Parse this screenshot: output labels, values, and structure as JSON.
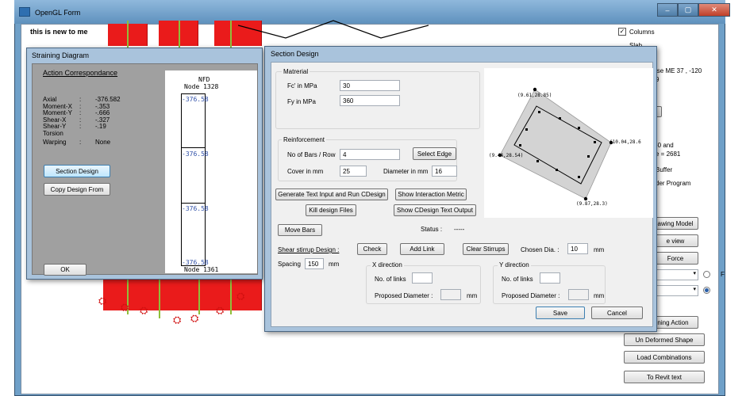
{
  "app": {
    "title": "OpenGL Form",
    "canvas_text": "this is new to me",
    "window_buttons": [
      "–",
      "▢",
      "✕"
    ]
  },
  "right_panel": {
    "columns_label": "Columns",
    "columns_checked": true,
    "partial_label_1": "Slab",
    "partial_texts": [
      "ise  ME  37 , -120",
      "9",
      "-0 and",
      "e = 2681",
      "Buffer",
      "der Program"
    ],
    "radio_label": "F",
    "buttons": {
      "drawing_model": "awing Model",
      "view": "e view",
      "force": "Force",
      "straining_action": "ning Action",
      "undeformed": "Un Deformed Shape",
      "load_combinations": "Load Combinations",
      "to_revit": "To Revit text"
    }
  },
  "straining": {
    "title": "Straining Diagram",
    "heading": "Action Correspondance",
    "rows": [
      {
        "label": "Axial",
        "sep": ":",
        "value": "-376.582"
      },
      {
        "label": "Moment-X",
        "sep": ":",
        "value": "-.353"
      },
      {
        "label": "Moment-Y",
        "sep": ":",
        "value": "-.666"
      },
      {
        "label": "Shear-X",
        "sep": ":",
        "value": "-.327"
      },
      {
        "label": "Shear-Y",
        "sep": ":",
        "value": "-.19"
      },
      {
        "label": "Torsion",
        "sep": "",
        "value": ""
      },
      {
        "label": "Warping",
        "sep": ":",
        "value": "None"
      }
    ],
    "section_design_btn": "Section Design",
    "copy_design_btn": "Copy Design From",
    "ok_btn": "OK",
    "diagram": {
      "title": "NFD",
      "node_top": "Node 1328",
      "node_bottom": "Node 1361",
      "value_1": "-376.58",
      "value_2": "-376.58",
      "value_3": "-376.58",
      "value_4": "-376.58"
    }
  },
  "section": {
    "title": "Section Design",
    "material": {
      "legend": "Matrerial",
      "fc_label": "Fc' in MPa",
      "fc_value": "30",
      "fy_label": "Fy in MPa",
      "fy_value": "360"
    },
    "reinforcement": {
      "legend": "Reinforcement",
      "bars_label": "No of Bars / Row",
      "bars_value": "4",
      "select_edge_btn": "Select Edge",
      "cover_label": "Cover in mm",
      "cover_value": "25",
      "diameter_label": "Diameter in mm",
      "diameter_value": "16"
    },
    "buttons": {
      "generate": "Generate Text Input and Run CDesign",
      "interaction": "Show Interaction Metric",
      "kill": "Kill design Files",
      "cdesign_output": "Show CDesign Text Output",
      "move_bars": "Move Bars",
      "check": "Check",
      "add_link": "Add Link",
      "clear_stirrups": "Clear Stirrups",
      "save": "Save",
      "cancel": "Cancel"
    },
    "status_label": "Status :",
    "status_value": "-----",
    "shear_label": "Shear stirrup Design :",
    "chosen_dia_label": "Chosen Dia. :",
    "chosen_dia_value": "10",
    "chosen_dia_unit": "mm",
    "spacing_label": "Spacing",
    "spacing_value": "150",
    "spacing_unit": "mm",
    "x_dir": {
      "legend": "X direction",
      "links_label": "No. of links",
      "links_value": "",
      "diam_label": "Proposed Diameter :",
      "diam_value": "",
      "unit": "mm"
    },
    "y_dir": {
      "legend": "Y direction",
      "links_label": "No. of links",
      "links_value": "",
      "diam_label": "Proposed Diameter :",
      "diam_value": "",
      "unit": "mm"
    },
    "preview": {
      "pt_top": "(9.61,28.85)",
      "pt_right": "(10.04,28.6",
      "pt_left": "(9.44,28.54)",
      "pt_bottom": "(9.87,28.3)"
    }
  },
  "colors": {
    "frame": "#6fa0c8",
    "structure_red": "#ea1b1b",
    "dialog_body": "#f0f0f0"
  }
}
